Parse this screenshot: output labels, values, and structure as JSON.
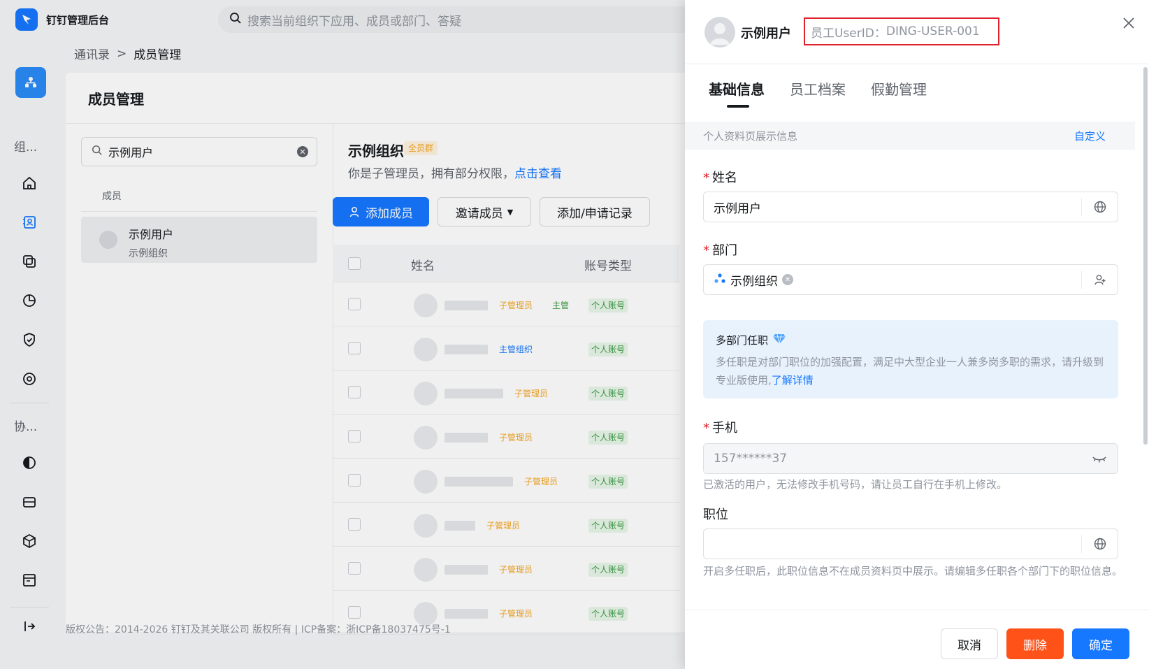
{
  "app": {
    "title": "钉钉管理后台",
    "search_placeholder": "搜索当前组织下应用、成员或部门、答疑"
  },
  "breadcrumb": {
    "root": "通讯录",
    "separator": ">",
    "current": "成员管理"
  },
  "nav": {
    "group1": "组...",
    "group2": "协..."
  },
  "main": {
    "page_title": "成员管理",
    "member_search_value": "示例用户",
    "members_label": "成员",
    "result": {
      "name": "示例用户",
      "org": "示例组织"
    },
    "org_title": "示例组织",
    "org_badge": "全员群",
    "org_desc": "你是子管理员，拥有部分权限，",
    "org_desc_link": "点击查看",
    "buttons": {
      "add_member": "添加成员",
      "invite_member": "邀请成员",
      "records": "添加/申请记录"
    },
    "table": {
      "col_name": "姓名",
      "col_account": "账号类型",
      "rows": [
        {
          "tags": [
            "子管理员",
            "主管"
          ],
          "account": "个人账号"
        },
        {
          "tags": [
            "主管组织"
          ],
          "account": "个人账号"
        },
        {
          "tags": [
            "子管理员"
          ],
          "account": "个人账号"
        },
        {
          "tags": [
            "子管理员"
          ],
          "account": "个人账号"
        },
        {
          "tags": [
            "子管理员"
          ],
          "account": "个人账号"
        },
        {
          "tags": [
            "子管理员"
          ],
          "account": "个人账号"
        },
        {
          "tags": [
            "子管理员"
          ],
          "account": "个人账号"
        },
        {
          "tags": [
            "子管理员"
          ],
          "account": "个人账号"
        }
      ]
    },
    "footer": "版权公告：2014-2026 钉钉及其关联公司 版权所有 | ICP备案：浙ICP备18037475号-1"
  },
  "drawer": {
    "user_name": "示例用户",
    "userid_label": "员工UserID：",
    "userid_value": "DING-USER-001",
    "tabs": [
      "基础信息",
      "员工档案",
      "假勤管理"
    ],
    "section_label": "个人资料页展示信息",
    "section_action": "自定义",
    "fields": {
      "name_label": "姓名",
      "name_value": "示例用户",
      "dept_label": "部门",
      "dept_value": "示例组织",
      "phone_label": "手机",
      "phone_value": "157******37",
      "phone_help": "已激活的用户，无法修改手机号码，请让员工自行在手机上修改。",
      "position_label": "职位",
      "position_value": "",
      "position_help": "开启多任职后，此职位信息不在成员资料页中展示。请编辑多任职各个部门下的职位信息。"
    },
    "info_box": {
      "title": "多部门任职",
      "text": "多任职是对部门职位的加强配置，满足中大型企业一人兼多岗多职的需求，请升级到专业版使用,",
      "link": "了解详情"
    },
    "footer": {
      "cancel": "取消",
      "delete": "删除",
      "confirm": "确定"
    }
  },
  "colors": {
    "primary": "#1677ff",
    "danger": "#ff5219",
    "highlight_border": "#e0202b"
  }
}
